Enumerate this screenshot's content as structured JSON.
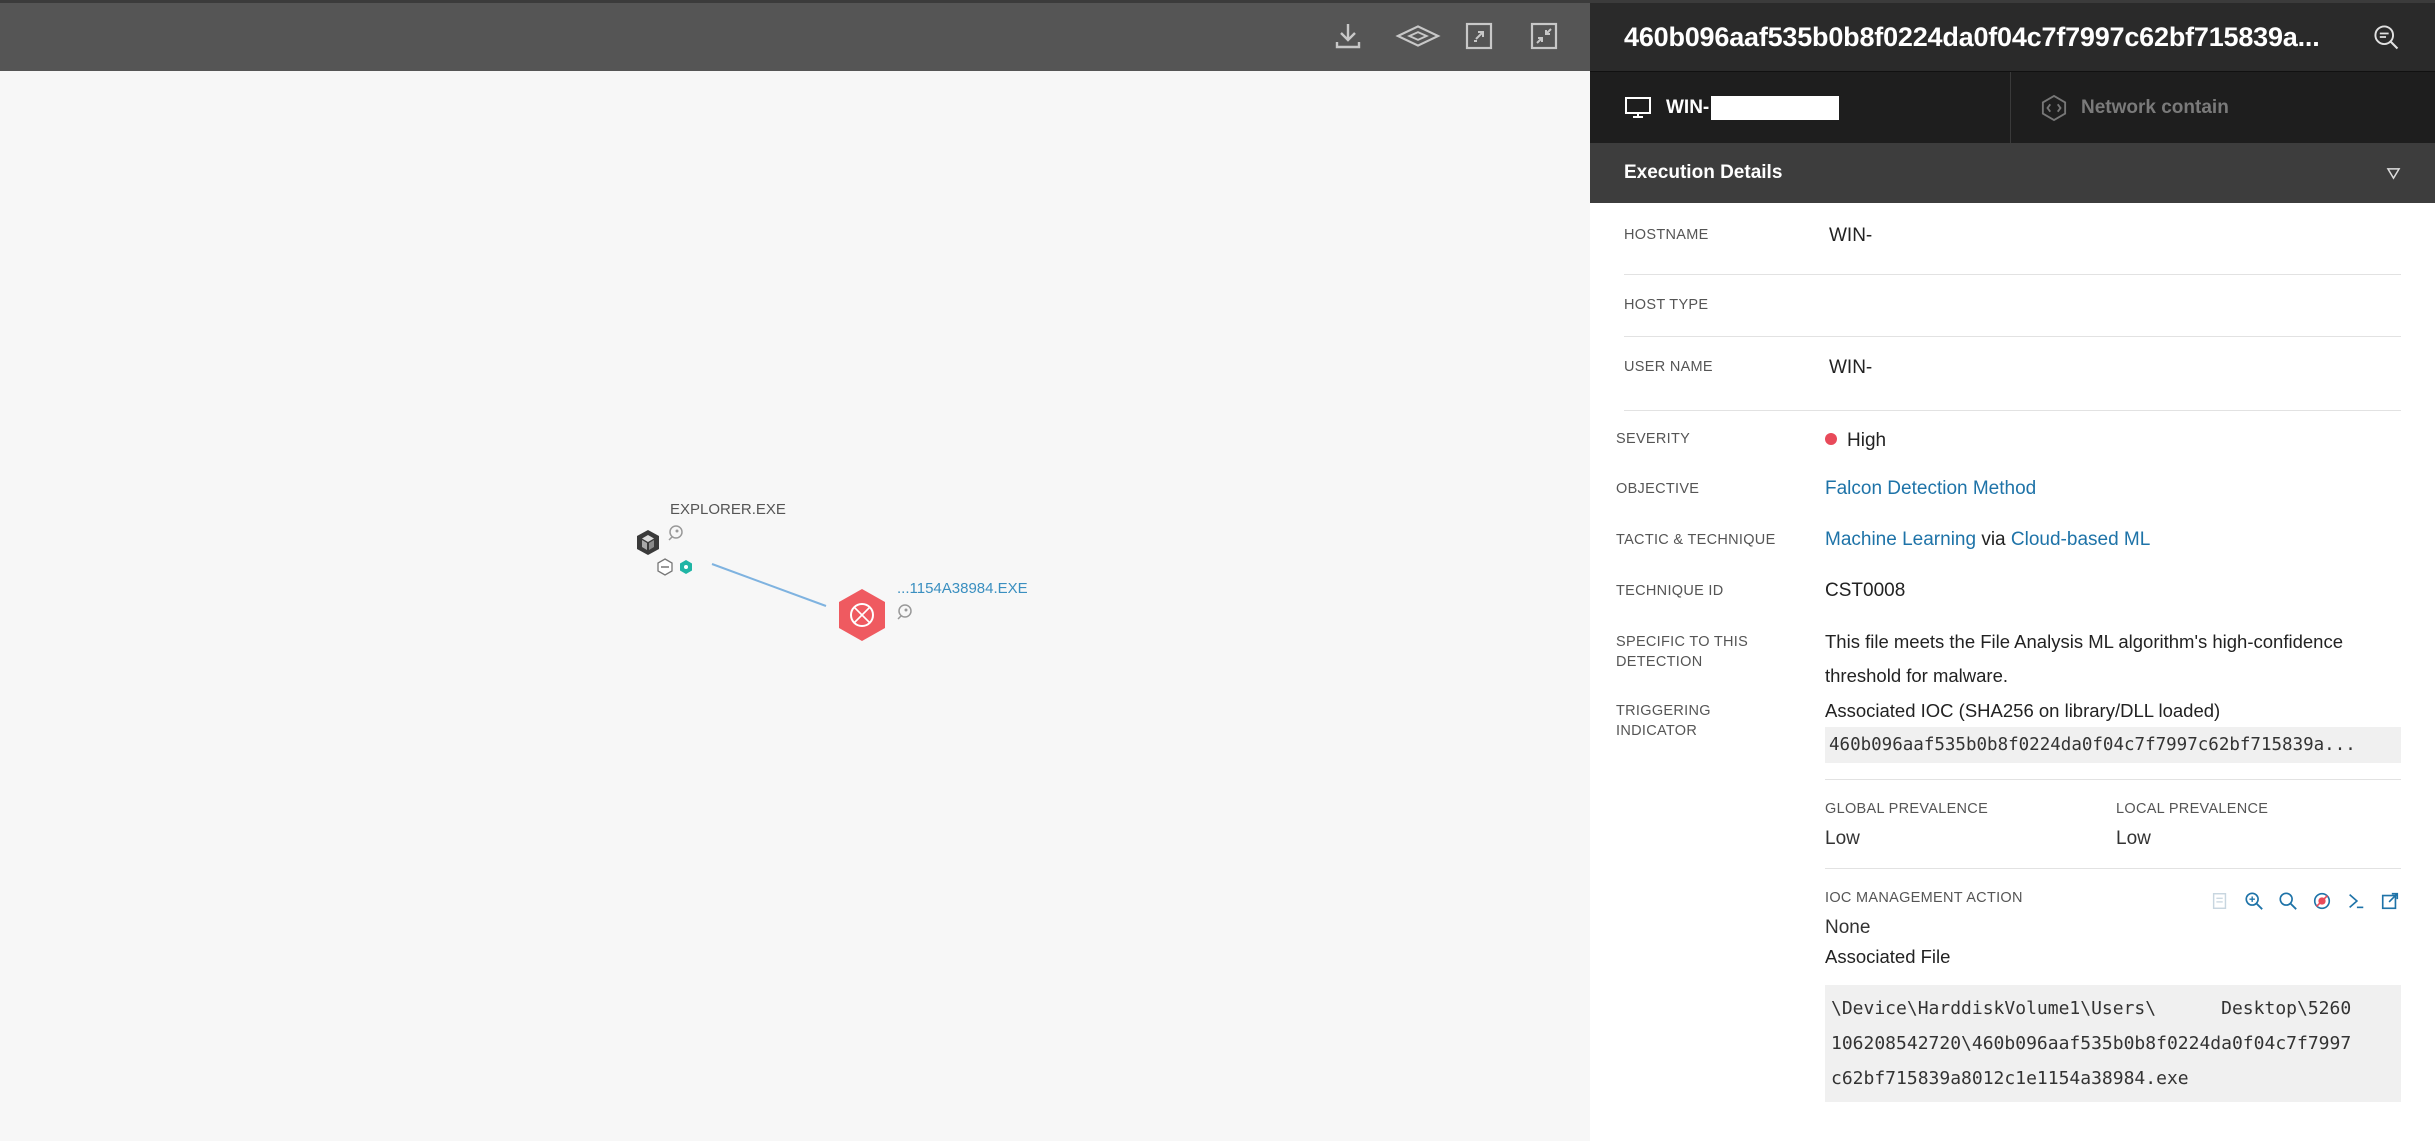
{
  "graph": {
    "toolbar_icons": [
      "download-icon",
      "layers-icon",
      "expand-icon",
      "collapse-icon"
    ],
    "nodes": {
      "parent": {
        "label": "EXPLORER.EXE"
      },
      "child": {
        "label": "...1154A38984.EXE"
      }
    }
  },
  "panel": {
    "title": "460b096aaf535b0b8f0224da0f04c7f7997c62bf715839a...",
    "tabs": {
      "host_label": "WIN-",
      "contain_label": "Network contain"
    },
    "section_title": "Execution Details",
    "fields": {
      "hostname_label": "HOSTNAME",
      "hostname_value": "WIN-",
      "host_type_label": "HOST TYPE",
      "host_type_value": "",
      "user_name_label": "USER NAME",
      "user_name_value": "WIN-",
      "severity_label": "SEVERITY",
      "severity_value": "High",
      "objective_label": "OBJECTIVE",
      "objective_value": "Falcon Detection Method",
      "tactic_label": "TACTIC & TECHNIQUE",
      "tactic_value": "Machine Learning",
      "tactic_via": "via",
      "technique_value": "Cloud-based ML",
      "technique_id_label": "TECHNIQUE ID",
      "technique_id_value": "CST0008",
      "specific_label": "SPECIFIC TO THIS DETECTION",
      "specific_value": "This file meets the File Analysis ML algorithm's high-confidence threshold for malware.",
      "triggering_label": "TRIGGERING INDICATOR",
      "ioc_heading": "Associated IOC (SHA256 on library/DLL loaded)",
      "ioc_hash": "460b096aaf535b0b8f0224da0f04c7f7997c62bf715839a...",
      "global_prevalence_label": "GLOBAL PREVALENCE",
      "global_prevalence_value": "Low",
      "local_prevalence_label": "LOCAL PREVALENCE",
      "local_prevalence_value": "Low",
      "ioc_action_label": "IOC MANAGEMENT ACTION",
      "ioc_action_value": "None",
      "associated_file_label": "Associated File",
      "associated_file_line1": "\\Device\\HarddiskVolume1\\Users\\      Desktop\\5260",
      "associated_file_line2": "106208542720\\460b096aaf535b0b8f0224da0f04c7f7997",
      "associated_file_line3": "c62bf715839a8012c1e1154a38984.exe"
    },
    "colors": {
      "severity_high": "#e84a5a",
      "link": "#1e73a8",
      "child_node": "#ef5a60",
      "edge": "#7fb3e0",
      "teal": "#1fb5a5"
    }
  }
}
